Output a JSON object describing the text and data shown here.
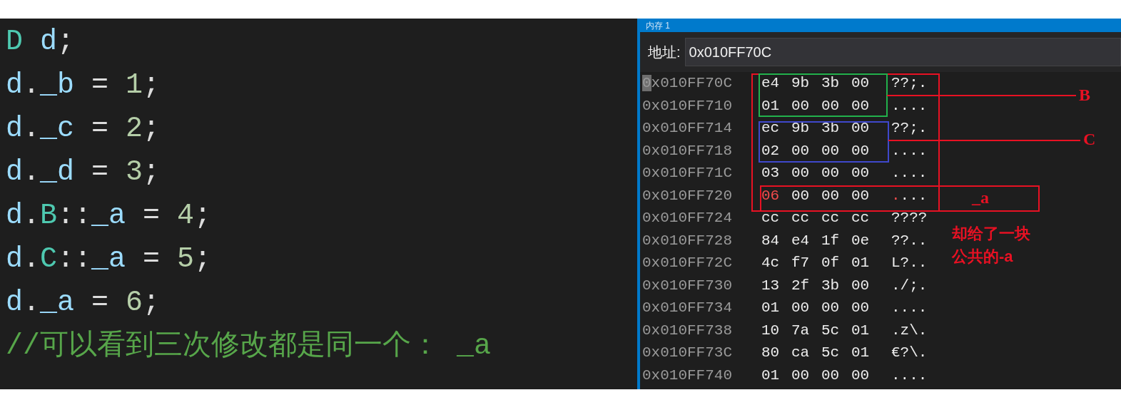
{
  "code_editor": {
    "lines": [
      [
        {
          "kind": "type",
          "text": "D "
        },
        {
          "kind": "var",
          "text": "d"
        },
        {
          "kind": "plain",
          "text": ";"
        }
      ],
      [
        {
          "kind": "var",
          "text": "d"
        },
        {
          "kind": "plain",
          "text": "."
        },
        {
          "kind": "var",
          "text": "_b"
        },
        {
          "kind": "plain",
          "text": " = "
        },
        {
          "kind": "number",
          "text": "1"
        },
        {
          "kind": "plain",
          "text": ";"
        }
      ],
      [
        {
          "kind": "var",
          "text": "d"
        },
        {
          "kind": "plain",
          "text": "."
        },
        {
          "kind": "var",
          "text": "_c"
        },
        {
          "kind": "plain",
          "text": " = "
        },
        {
          "kind": "number",
          "text": "2"
        },
        {
          "kind": "plain",
          "text": ";"
        }
      ],
      [
        {
          "kind": "var",
          "text": "d"
        },
        {
          "kind": "plain",
          "text": "."
        },
        {
          "kind": "var",
          "text": "_d"
        },
        {
          "kind": "plain",
          "text": " = "
        },
        {
          "kind": "number",
          "text": "3"
        },
        {
          "kind": "plain",
          "text": ";"
        }
      ],
      [
        {
          "kind": "var",
          "text": "d"
        },
        {
          "kind": "plain",
          "text": "."
        },
        {
          "kind": "type",
          "text": "B"
        },
        {
          "kind": "plain",
          "text": "::"
        },
        {
          "kind": "var",
          "text": "_a"
        },
        {
          "kind": "plain",
          "text": " = "
        },
        {
          "kind": "number",
          "text": "4"
        },
        {
          "kind": "plain",
          "text": ";"
        }
      ],
      [
        {
          "kind": "var",
          "text": "d"
        },
        {
          "kind": "plain",
          "text": "."
        },
        {
          "kind": "type",
          "text": "C"
        },
        {
          "kind": "plain",
          "text": "::"
        },
        {
          "kind": "var",
          "text": "_a"
        },
        {
          "kind": "plain",
          "text": " = "
        },
        {
          "kind": "number",
          "text": "5"
        },
        {
          "kind": "plain",
          "text": ";"
        }
      ],
      [
        {
          "kind": "var",
          "text": "d"
        },
        {
          "kind": "plain",
          "text": "."
        },
        {
          "kind": "var",
          "text": "_a"
        },
        {
          "kind": "plain",
          "text": " = "
        },
        {
          "kind": "number",
          "text": "6"
        },
        {
          "kind": "plain",
          "text": ";"
        }
      ],
      [
        {
          "kind": "comment",
          "text": "//可以看到三次修改都是同一个： _a"
        }
      ]
    ]
  },
  "memory_window": {
    "title": "内存 1",
    "address_label": "地址:",
    "address_value": "0x010FF70C",
    "rows": [
      {
        "address": "0x010FF70C",
        "bytes": [
          "e4",
          "9b",
          "3b",
          "00"
        ],
        "ascii": "??;.",
        "cursor": true,
        "changed": false
      },
      {
        "address": "0x010FF710",
        "bytes": [
          "01",
          "00",
          "00",
          "00"
        ],
        "ascii": "....",
        "cursor": false,
        "changed": false
      },
      {
        "address": "0x010FF714",
        "bytes": [
          "ec",
          "9b",
          "3b",
          "00"
        ],
        "ascii": "??;.",
        "cursor": false,
        "changed": false
      },
      {
        "address": "0x010FF718",
        "bytes": [
          "02",
          "00",
          "00",
          "00"
        ],
        "ascii": "....",
        "cursor": false,
        "changed": false
      },
      {
        "address": "0x010FF71C",
        "bytes": [
          "03",
          "00",
          "00",
          "00"
        ],
        "ascii": "....",
        "cursor": false,
        "changed": false
      },
      {
        "address": "0x010FF720",
        "bytes": [
          "06",
          "00",
          "00",
          "00"
        ],
        "ascii": "....",
        "cursor": false,
        "changed": true
      },
      {
        "address": "0x010FF724",
        "bytes": [
          "cc",
          "cc",
          "cc",
          "cc"
        ],
        "ascii": "????",
        "cursor": false,
        "changed": false
      },
      {
        "address": "0x010FF728",
        "bytes": [
          "84",
          "e4",
          "1f",
          "0e"
        ],
        "ascii": "??..",
        "cursor": false,
        "changed": false
      },
      {
        "address": "0x010FF72C",
        "bytes": [
          "4c",
          "f7",
          "0f",
          "01"
        ],
        "ascii": "L?..",
        "cursor": false,
        "changed": false
      },
      {
        "address": "0x010FF730",
        "bytes": [
          "13",
          "2f",
          "3b",
          "00"
        ],
        "ascii": "./;.",
        "cursor": false,
        "changed": false
      },
      {
        "address": "0x010FF734",
        "bytes": [
          "01",
          "00",
          "00",
          "00"
        ],
        "ascii": "....",
        "cursor": false,
        "changed": false
      },
      {
        "address": "0x010FF738",
        "bytes": [
          "10",
          "7a",
          "5c",
          "01"
        ],
        "ascii": ".z\\.",
        "cursor": false,
        "changed": false
      },
      {
        "address": "0x010FF73C",
        "bytes": [
          "80",
          "ca",
          "5c",
          "01"
        ],
        "ascii": "€?\\.",
        "cursor": false,
        "changed": false
      },
      {
        "address": "0x010FF740",
        "bytes": [
          "01",
          "00",
          "00",
          "00"
        ],
        "ascii": "....",
        "cursor": false,
        "changed": false
      }
    ]
  },
  "annotations": [
    {
      "kind": "outline",
      "color": "#e81123"
    },
    {
      "kind": "labeled_box",
      "label": "B",
      "color": "#22b14c"
    },
    {
      "kind": "labeled_box",
      "label": "C",
      "color": "#3f48cc"
    },
    {
      "kind": "labeled_box",
      "label": "_a",
      "color": "#e81123"
    },
    {
      "kind": "note",
      "lines": [
        "却给了一块",
        "公共的-a"
      ],
      "color": "#e81123"
    }
  ]
}
